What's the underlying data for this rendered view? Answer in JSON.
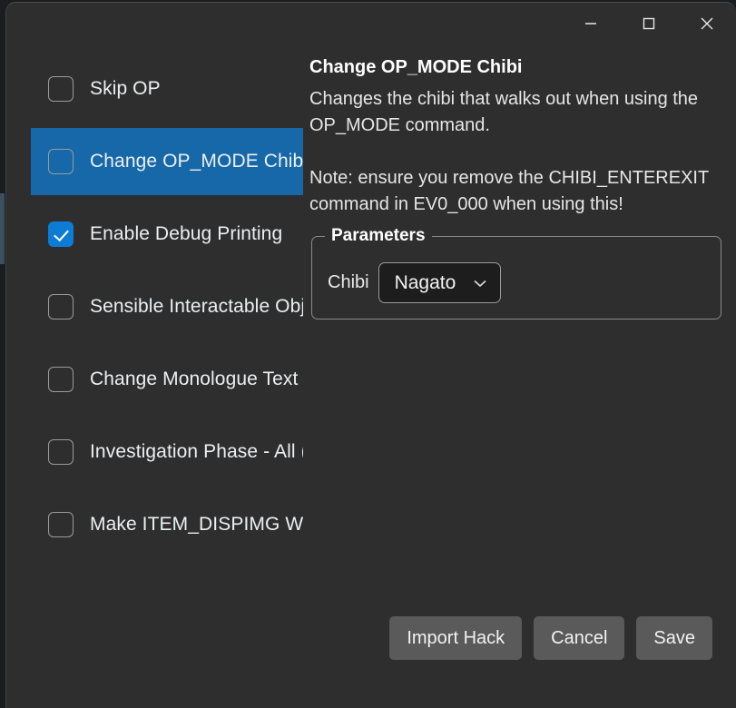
{
  "window": {
    "titlebar": {
      "minimize_tooltip": "Minimize",
      "maximize_tooltip": "Maximize",
      "close_tooltip": "Close"
    },
    "background_color": "#2e2e2e",
    "accent_color": "#1668a8",
    "checkbox_checked_color": "#0d7cd5"
  },
  "hack_list": {
    "items": [
      {
        "label": "Skip OP",
        "checked": false,
        "selected": false
      },
      {
        "label": "Change OP_MODE Chibi",
        "checked": false,
        "selected": true
      },
      {
        "label": "Enable Debug Printing",
        "checked": true,
        "selected": false
      },
      {
        "label": "Sensible Interactable Obj",
        "checked": false,
        "selected": false
      },
      {
        "label": "Change Monologue Text",
        "checked": false,
        "selected": false
      },
      {
        "label": "Investigation Phase - All (",
        "checked": false,
        "selected": false
      },
      {
        "label": "Make ITEM_DISPIMG Wo",
        "checked": false,
        "selected": false
      }
    ]
  },
  "detail": {
    "title": "Change OP_MODE Chibi",
    "description": "Changes the chibi that walks out when using the OP_MODE command.\n\nNote: ensure you remove the CHIBI_ENTEREXIT command in EV0_000 when using this!"
  },
  "parameters": {
    "legend": "Parameters",
    "fields": [
      {
        "label": "Chibi",
        "value": "Nagato",
        "options": [
          "Nagato"
        ]
      }
    ]
  },
  "footer": {
    "import_label": "Import Hack",
    "cancel_label": "Cancel",
    "save_label": "Save"
  }
}
